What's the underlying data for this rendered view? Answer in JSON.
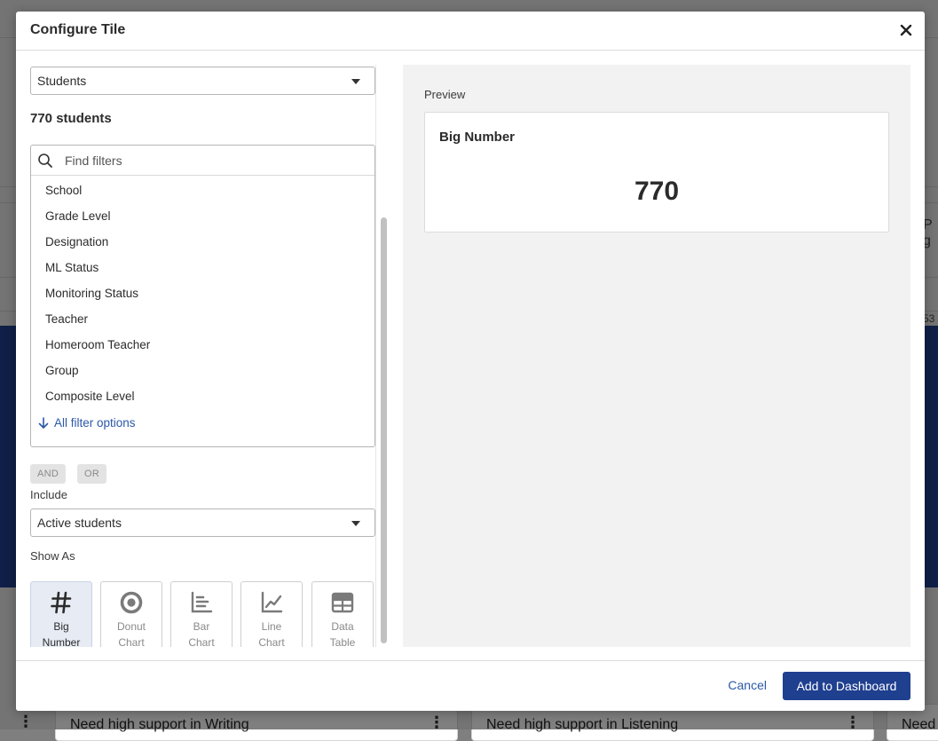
{
  "background": {
    "cards": [
      {
        "title": "Need high support in Writing"
      },
      {
        "title": "Need high support in Listening"
      },
      {
        "title": "Need"
      }
    ],
    "right_text": "P g",
    "right_number": "53"
  },
  "modal": {
    "title": "Configure Tile",
    "close_icon": "close-icon"
  },
  "source_select": {
    "value": "Students"
  },
  "student_count": "770 students",
  "filters": {
    "search_placeholder": "Find filters",
    "items": [
      {
        "label": "School"
      },
      {
        "label": "Grade Level"
      },
      {
        "label": "Designation"
      },
      {
        "label": "ML Status"
      },
      {
        "label": "Monitoring Status"
      },
      {
        "label": "Teacher"
      },
      {
        "label": "Homeroom Teacher"
      },
      {
        "label": "Group"
      },
      {
        "label": "Composite Level"
      }
    ],
    "all_options_label": "All filter options"
  },
  "logic": {
    "and_label": "AND",
    "or_label": "OR"
  },
  "include": {
    "label": "Include",
    "value": "Active students"
  },
  "show_as": {
    "label": "Show As",
    "selected": "big-number",
    "options": [
      {
        "id": "big-number",
        "line1": "Big",
        "line2": "Number",
        "icon": "hash-icon"
      },
      {
        "id": "donut-chart",
        "line1": "Donut",
        "line2": "Chart",
        "icon": "donut-chart-icon"
      },
      {
        "id": "bar-chart",
        "line1": "Bar",
        "line2": "Chart",
        "icon": "bar-chart-icon"
      },
      {
        "id": "line-chart",
        "line1": "Line",
        "line2": "Chart",
        "icon": "line-chart-icon"
      },
      {
        "id": "data-table",
        "line1": "Data",
        "line2": "Table",
        "icon": "table-icon"
      }
    ]
  },
  "preview": {
    "label": "Preview",
    "card_title": "Big Number",
    "value": "770"
  },
  "footer": {
    "cancel_label": "Cancel",
    "add_label": "Add to Dashboard"
  },
  "colors": {
    "primary": "#1f3f8f",
    "link": "#2a58a8",
    "selected_option_bg": "#e6ebf4",
    "preview_bg": "#f2f2f2"
  }
}
